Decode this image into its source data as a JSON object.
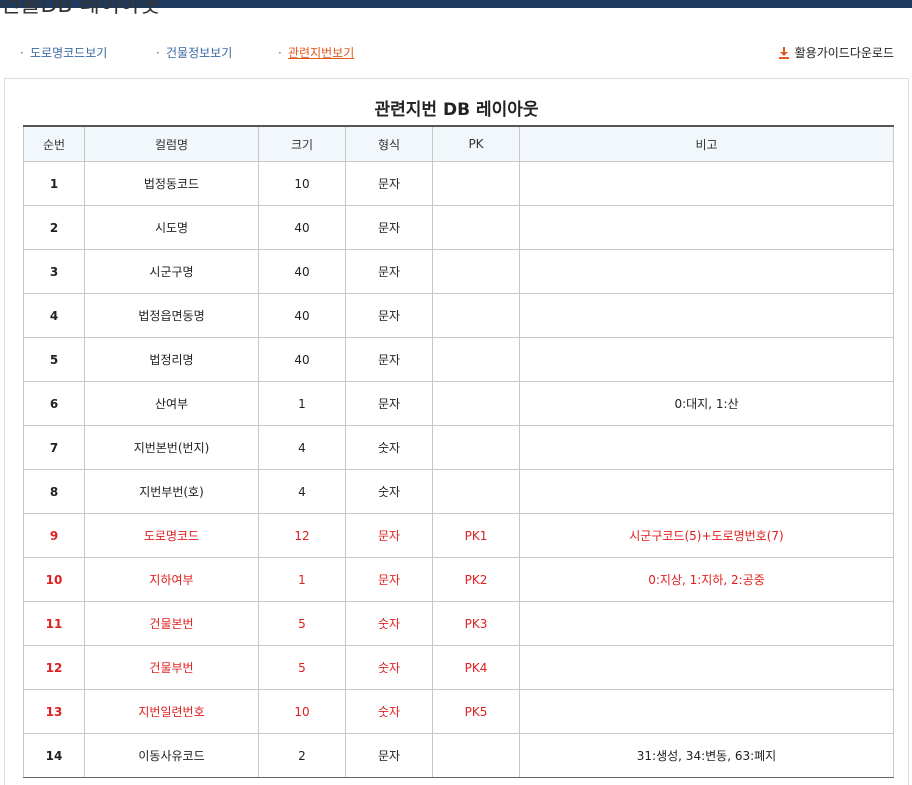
{
  "page_title": "건물DB 레이아웃",
  "tabs": [
    {
      "label": "도로명코드보기",
      "active": false
    },
    {
      "label": "건물정보보기",
      "active": false
    },
    {
      "label": "관련지번보기",
      "active": true
    }
  ],
  "tab_bullet": "·",
  "download_label": "활용가이드다운로드",
  "accent_color": "#e05a1b",
  "link_color": "#3b6aa6",
  "pk_color": "#e02020",
  "panel_title": "관련지번 DB 레이아웃",
  "columns": [
    "순번",
    "컬럼명",
    "크기",
    "형식",
    "PK",
    "비고"
  ],
  "rows": [
    {
      "no": "1",
      "name": "법정동코드",
      "size": "10",
      "type": "문자",
      "pk": "",
      "note": ""
    },
    {
      "no": "2",
      "name": "시도명",
      "size": "40",
      "type": "문자",
      "pk": "",
      "note": ""
    },
    {
      "no": "3",
      "name": "시군구명",
      "size": "40",
      "type": "문자",
      "pk": "",
      "note": ""
    },
    {
      "no": "4",
      "name": "법정읍면동명",
      "size": "40",
      "type": "문자",
      "pk": "",
      "note": ""
    },
    {
      "no": "5",
      "name": "법정리명",
      "size": "40",
      "type": "문자",
      "pk": "",
      "note": ""
    },
    {
      "no": "6",
      "name": "산여부",
      "size": "1",
      "type": "문자",
      "pk": "",
      "note": "0:대지, 1:산"
    },
    {
      "no": "7",
      "name": "지번본번(번지)",
      "size": "4",
      "type": "숫자",
      "pk": "",
      "note": ""
    },
    {
      "no": "8",
      "name": "지번부번(호)",
      "size": "4",
      "type": "숫자",
      "pk": "",
      "note": ""
    },
    {
      "no": "9",
      "name": "도로명코드",
      "size": "12",
      "type": "문자",
      "pk": "PK1",
      "note": "시군구코드(5)+도로명번호(7)"
    },
    {
      "no": "10",
      "name": "지하여부",
      "size": "1",
      "type": "문자",
      "pk": "PK2",
      "note": "0:지상, 1:지하, 2:공중"
    },
    {
      "no": "11",
      "name": "건물본번",
      "size": "5",
      "type": "숫자",
      "pk": "PK3",
      "note": ""
    },
    {
      "no": "12",
      "name": "건물부번",
      "size": "5",
      "type": "숫자",
      "pk": "PK4",
      "note": ""
    },
    {
      "no": "13",
      "name": "지번일련번호",
      "size": "10",
      "type": "숫자",
      "pk": "PK5",
      "note": ""
    },
    {
      "no": "14",
      "name": "이동사유코드",
      "size": "2",
      "type": "문자",
      "pk": "",
      "note": "31:생성, 34:변동, 63:폐지"
    }
  ]
}
